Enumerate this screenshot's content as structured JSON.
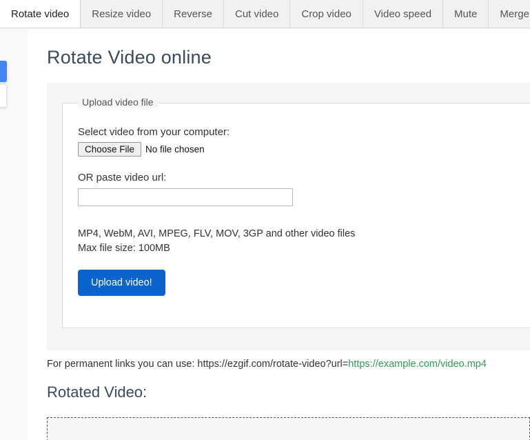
{
  "tabs": [
    {
      "label": "Rotate video",
      "active": true
    },
    {
      "label": "Resize video",
      "active": false
    },
    {
      "label": "Reverse",
      "active": false
    },
    {
      "label": "Cut video",
      "active": false
    },
    {
      "label": "Crop video",
      "active": false
    },
    {
      "label": "Video speed",
      "active": false
    },
    {
      "label": "Mute",
      "active": false
    },
    {
      "label": "Merge video",
      "active": false
    }
  ],
  "page": {
    "title": "Rotate Video online"
  },
  "upload": {
    "legend": "Upload video file",
    "select_file_label": "Select video from your computer:",
    "choose_file_button": "Choose File",
    "file_status": "No file chosen",
    "paste_url_label": "OR paste video url:",
    "url_value": "",
    "url_placeholder": "",
    "formats_line": "MP4, WebM, AVI, MPEG, FLV, MOV, 3GP and other video files",
    "maxsize_line": "Max file size: 100MB",
    "submit_button": "Upload video!"
  },
  "permalink": {
    "prefix": "For permanent links you can use: https://ezgif.com/rotate-video?url=",
    "example_url": "https://example.com/video.mp4"
  },
  "result": {
    "title": "Rotated Video:"
  },
  "colors": {
    "accent_blue": "#0b63ce",
    "edge_widget_blue": "#4285f4",
    "link_green": "#2e9e4f",
    "panel_gray": "#f4f5f7",
    "tabbar_gray": "#f1f1f1"
  }
}
